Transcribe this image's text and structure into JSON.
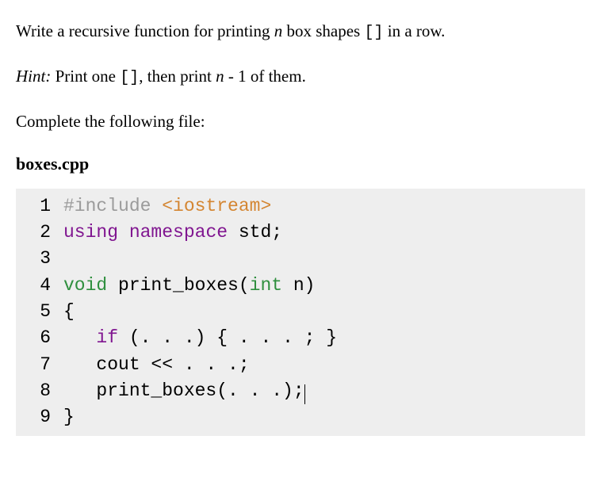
{
  "instructions": {
    "line1_part1": "Write a recursive function for printing ",
    "line1_n": "n",
    "line1_part2": " box shapes ",
    "line1_code": "[]",
    "line1_part3": " in a row.",
    "hint_label": "Hint:",
    "hint_part1": " Print one ",
    "hint_code": "[]",
    "hint_part2": ", then print ",
    "hint_n": "n",
    "hint_part3": " - 1 of them.",
    "complete_text": "Complete the following file:"
  },
  "filename": "boxes.cpp",
  "code": {
    "lines": [
      {
        "num": "1",
        "tokens": [
          {
            "cls": "tk-macro",
            "t": "#include "
          },
          {
            "cls": "tk-include",
            "t": "<iostream>"
          }
        ]
      },
      {
        "num": "2",
        "tokens": [
          {
            "cls": "tk-keyword",
            "t": "using"
          },
          {
            "cls": "",
            "t": " "
          },
          {
            "cls": "tk-keyword",
            "t": "namespace"
          },
          {
            "cls": "",
            "t": " std;"
          }
        ]
      },
      {
        "num": "3",
        "tokens": []
      },
      {
        "num": "4",
        "tokens": [
          {
            "cls": "tk-type",
            "t": "void"
          },
          {
            "cls": "",
            "t": " print_boxes("
          },
          {
            "cls": "tk-type",
            "t": "int"
          },
          {
            "cls": "",
            "t": " n)"
          }
        ]
      },
      {
        "num": "5",
        "tokens": [
          {
            "cls": "",
            "t": "{"
          }
        ]
      },
      {
        "num": "6",
        "tokens": [
          {
            "cls": "",
            "t": "   "
          },
          {
            "cls": "tk-keyword",
            "t": "if"
          },
          {
            "cls": "",
            "t": " (. . .) { . . . ; }"
          }
        ]
      },
      {
        "num": "7",
        "tokens": [
          {
            "cls": "",
            "t": "   cout << . . .;"
          }
        ]
      },
      {
        "num": "8",
        "tokens": [
          {
            "cls": "",
            "t": "   print_boxes(. . .);"
          }
        ],
        "cursor": true
      },
      {
        "num": "9",
        "tokens": [
          {
            "cls": "",
            "t": "}"
          }
        ]
      }
    ]
  }
}
